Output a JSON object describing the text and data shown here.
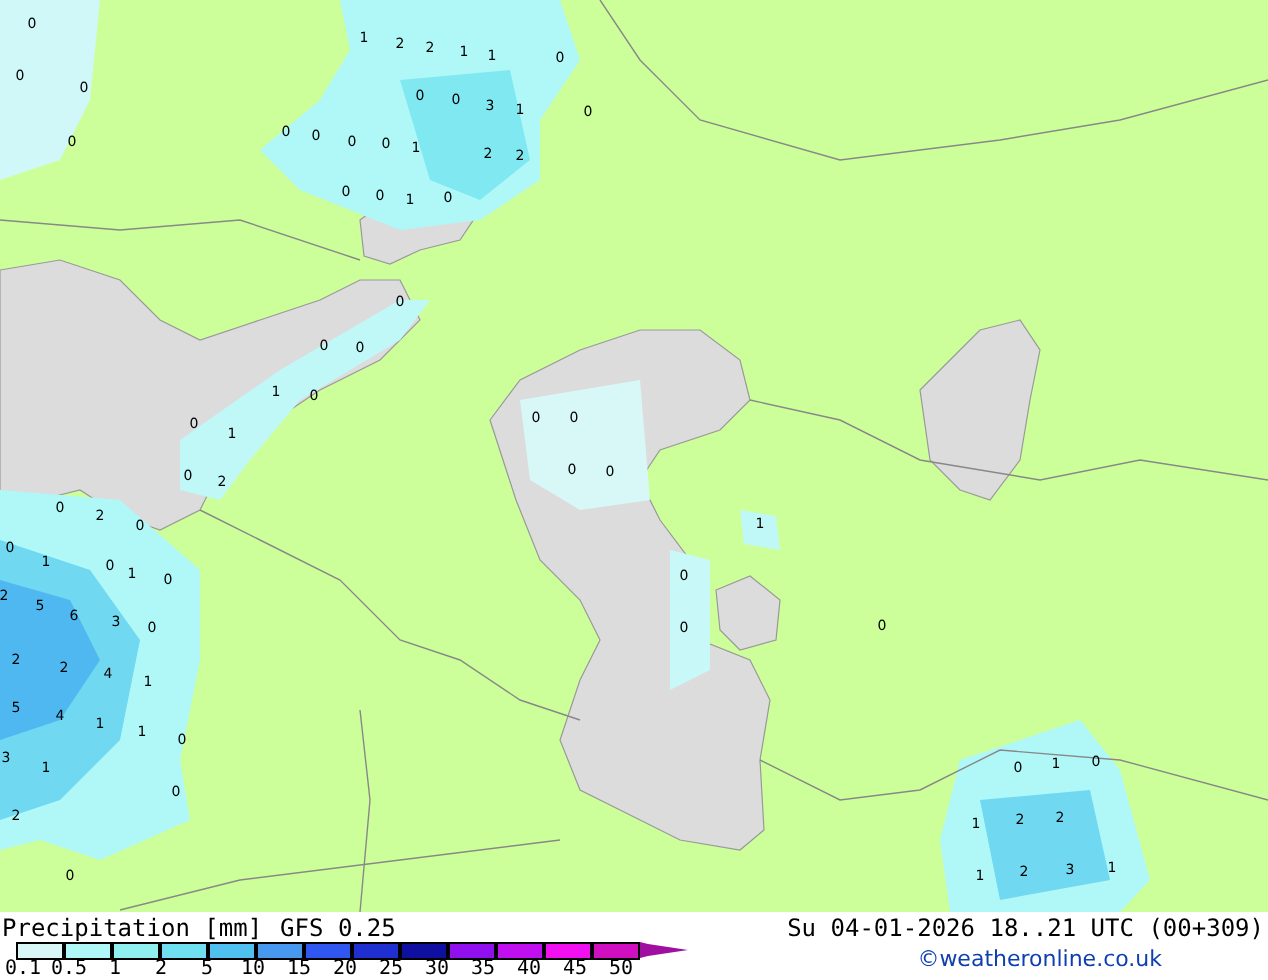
{
  "map": {
    "values": [
      "0",
      "0",
      "0",
      "0",
      "1",
      "2",
      "2",
      "1",
      "1",
      "0",
      "0",
      "0",
      "0",
      "0",
      "0",
      "0",
      "3",
      "1",
      "0",
      "1",
      "2",
      "2",
      "0",
      "0",
      "1",
      "0",
      "0",
      "0",
      "0",
      "1",
      "0",
      "0",
      "1",
      "0",
      "2",
      "0",
      "0",
      "0",
      "0",
      "1",
      "0",
      "0",
      "0",
      "0",
      "2",
      "0",
      "0",
      "1",
      "0",
      "1",
      "0",
      "5",
      "6",
      "3",
      "0",
      "2",
      "2",
      "2",
      "4",
      "1",
      "5",
      "4",
      "1",
      "1",
      "0",
      "3",
      "1",
      "2",
      "0",
      "0",
      "0",
      "1",
      "0",
      "1",
      "2",
      "2",
      "1",
      "2",
      "3",
      "1"
    ]
  },
  "footer": {
    "title": "Precipitation [mm]",
    "model": "GFS 0.25",
    "valid": "Su 04-01-2026 18..21 UTC (00+309)",
    "credit": "©weatheronline.co.uk",
    "legend": {
      "bins": [
        {
          "color": "#d8f8f8"
        },
        {
          "color": "#b0f8f8"
        },
        {
          "color": "#90f0f0"
        },
        {
          "color": "#70e0f0"
        },
        {
          "color": "#50c0f0"
        },
        {
          "color": "#4898f0"
        },
        {
          "color": "#3058f0"
        },
        {
          "color": "#2030d0"
        },
        {
          "color": "#1010a0"
        },
        {
          "color": "#9010f0"
        },
        {
          "color": "#c010f0"
        },
        {
          "color": "#f010f0"
        },
        {
          "color": "#d010c0"
        }
      ],
      "ticks": [
        "0.1",
        "0.5",
        "1",
        "2",
        "5",
        "10",
        "15",
        "20",
        "25",
        "30",
        "35",
        "40",
        "45",
        "50"
      ]
    }
  }
}
